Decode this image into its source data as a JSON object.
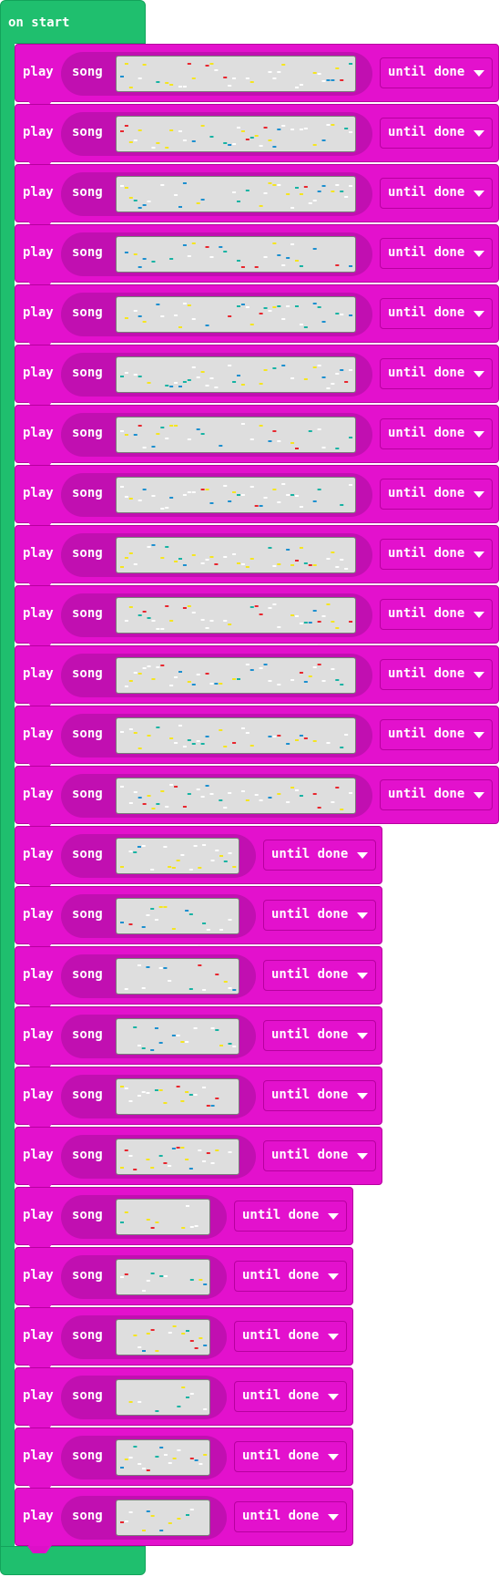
{
  "event": {
    "label": "on start"
  },
  "block_label_play": "play",
  "block_label_song": "song",
  "blocks": [
    {
      "mode": "until done"
    },
    {
      "mode": "until done"
    },
    {
      "mode": "until done"
    },
    {
      "mode": "until done"
    },
    {
      "mode": "until done"
    },
    {
      "mode": "until done"
    },
    {
      "mode": "until done"
    },
    {
      "mode": "until done"
    },
    {
      "mode": "until done"
    },
    {
      "mode": "until done"
    },
    {
      "mode": "until done"
    },
    {
      "mode": "until done"
    },
    {
      "mode": "until done"
    },
    {
      "mode": "until done"
    },
    {
      "mode": "until done"
    },
    {
      "mode": "until done"
    },
    {
      "mode": "until done"
    },
    {
      "mode": "until done"
    },
    {
      "mode": "until done"
    },
    {
      "mode": "until done"
    },
    {
      "mode": "until done"
    },
    {
      "mode": "until done"
    },
    {
      "mode": "until done"
    },
    {
      "mode": "until done"
    },
    {
      "mode": "until done"
    }
  ],
  "colors": {
    "event": "#1fbf6e",
    "block": "#e311cd",
    "pill": "#c10fb1",
    "note_white": "#ffffff",
    "note_yellow": "#f5e51f",
    "note_red": "#e8262e",
    "note_blue": "#1c8fcf",
    "note_teal": "#17b3a3"
  }
}
